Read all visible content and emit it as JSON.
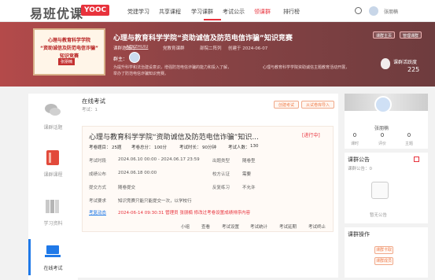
{
  "header": {
    "logo": "易班优课",
    "logo_badge": "YOOC",
    "nav": [
      "党建学习",
      "共享课程",
      "学习课群",
      "考试公示",
      "领课群",
      "排行榜"
    ],
    "user": "张朋楠"
  },
  "banner": {
    "cover_lines": [
      "心理与教育科学学院",
      "“资助诚信及防范电信诈骗”",
      "知识竞赛"
    ],
    "cover_name": "张朋楠",
    "title": "心理与教育科学学院“资助诚信及防范电信诈骗”知识竞赛",
    "code_label": "课群邀请码：",
    "code": "AZYZHUIU",
    "tag": "党教育课群",
    "status": "部院二阵列",
    "created": "创建于 2024-06-07",
    "teacher_label": "群主：",
    "desc1": "为提升科学和法治建设意识，增强防范电信诈骗的能力和投入了解，",
    "desc2": "心理与教育科学学院资助诚信主题教育活动开展，",
    "desc3": "举办了防范电信诈骗知识竞赛。",
    "btn1": "课群主页",
    "btn2": "管理课群",
    "hot_label": "课群活跃度",
    "hot_value": "225"
  },
  "left_nav": [
    {
      "label": "课群话题"
    },
    {
      "label": "课群课程"
    },
    {
      "label": "学习资料"
    },
    {
      "label": "在线考试"
    }
  ],
  "main": {
    "title": "在线考试",
    "count": "考试：1",
    "btn_create": "创建考试",
    "btn_import": "从试卷库导入",
    "exam": {
      "title": "心理与教育科学学院“资助诚信及防范电信诈骗”知识...",
      "status": "[进行中]",
      "total_label": "考卷题目：",
      "total": "25题",
      "score_label": "考卷总分：",
      "score": "100分",
      "time_label": "考试时长：",
      "time": "90分钟",
      "people_label": "考试人数：",
      "people": "130",
      "rows": [
        {
          "l1": "考试时段",
          "v1": "2024.06.10 00:00 - 2024.06.17 23:59",
          "l2": "出题类型",
          "v2": "随卷型"
        },
        {
          "l1": "成绩公布",
          "v1": "2024.06.18 00:00",
          "l2": "校方认证",
          "v2": "需要"
        },
        {
          "l1": "提交方式",
          "v1": "随卷提交",
          "l2": "反复练习",
          "v2": "不允许"
        }
      ],
      "req_label": "考试要求",
      "req": "知识竞赛只能只能提交一次，以学校行",
      "dyn_label": "考复动态",
      "dyn": "2024-06-14 09:30:31 管理员 张朋楠 修改过考卷设置成绩排序内容",
      "links": [
        "小组",
        "查看",
        "考试设置",
        "考试统计",
        "考试延期",
        "考试终止"
      ]
    }
  },
  "right": {
    "user": "张朋楠",
    "stats": [
      {
        "v": "0",
        "l": "课时"
      },
      {
        "v": "0",
        "l": "评价"
      },
      {
        "v": "0",
        "l": "主题"
      }
    ],
    "notice_title": "课群公告",
    "notice_count": "课群公告：0",
    "notice_empty": "暂无公告",
    "ops_title": "课群操作",
    "op1": "课群卡取",
    "op2": "课群成员"
  }
}
